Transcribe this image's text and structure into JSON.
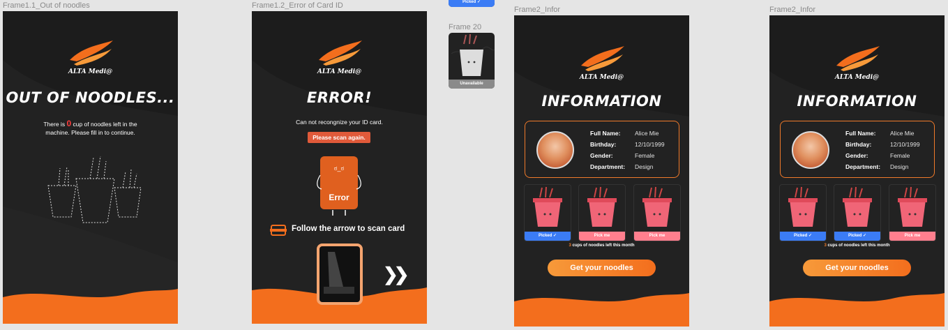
{
  "labels": {
    "f1": "Frame1.1_Out of noodles",
    "f2": "Frame1.2_Error of Card ID",
    "f20": "Frame 20",
    "f3": "Frame2_Infor",
    "f4": "Frame2_Infor"
  },
  "logo": {
    "text": "ALTA Medi@"
  },
  "out": {
    "title": "OUT OF NOODLES...",
    "line1_pre": "There is ",
    "line1_num": "0",
    "line1_post": " cup of noodles left in the",
    "line2": "machine. Please fill in to continue."
  },
  "error": {
    "title": "ERROR!",
    "message": "Can not recongnize your ID card.",
    "button": "Please scan again.",
    "card_label": "Error",
    "hint": "Follow the arrow to scan card"
  },
  "thumbs": {
    "top_tag": "Picked ✓",
    "bottom_tag": "Unavailable"
  },
  "info": {
    "title": "INFORMATION",
    "rows": [
      {
        "key": "Full Name:",
        "val": "Alice Mie"
      },
      {
        "key": "Birthday:",
        "val": "12/10/1999"
      },
      {
        "key": "Gender:",
        "val": "Female"
      },
      {
        "key": "Department:",
        "val": "Design"
      }
    ],
    "cups_num": "3",
    "cups_text": " cups of  noodles left this month",
    "button": "Get your noodles",
    "frame3_tags": [
      "Picked ✓",
      "Pick me",
      "Pick me"
    ],
    "frame4_tags": [
      "Picked ✓",
      "Picked ✓",
      "Pick me"
    ]
  },
  "colors": {
    "orange": "#f36e1d",
    "picked": "#3b7cf5",
    "pickme": "#ff7f8e",
    "unavailable": "#8a8a8a"
  }
}
